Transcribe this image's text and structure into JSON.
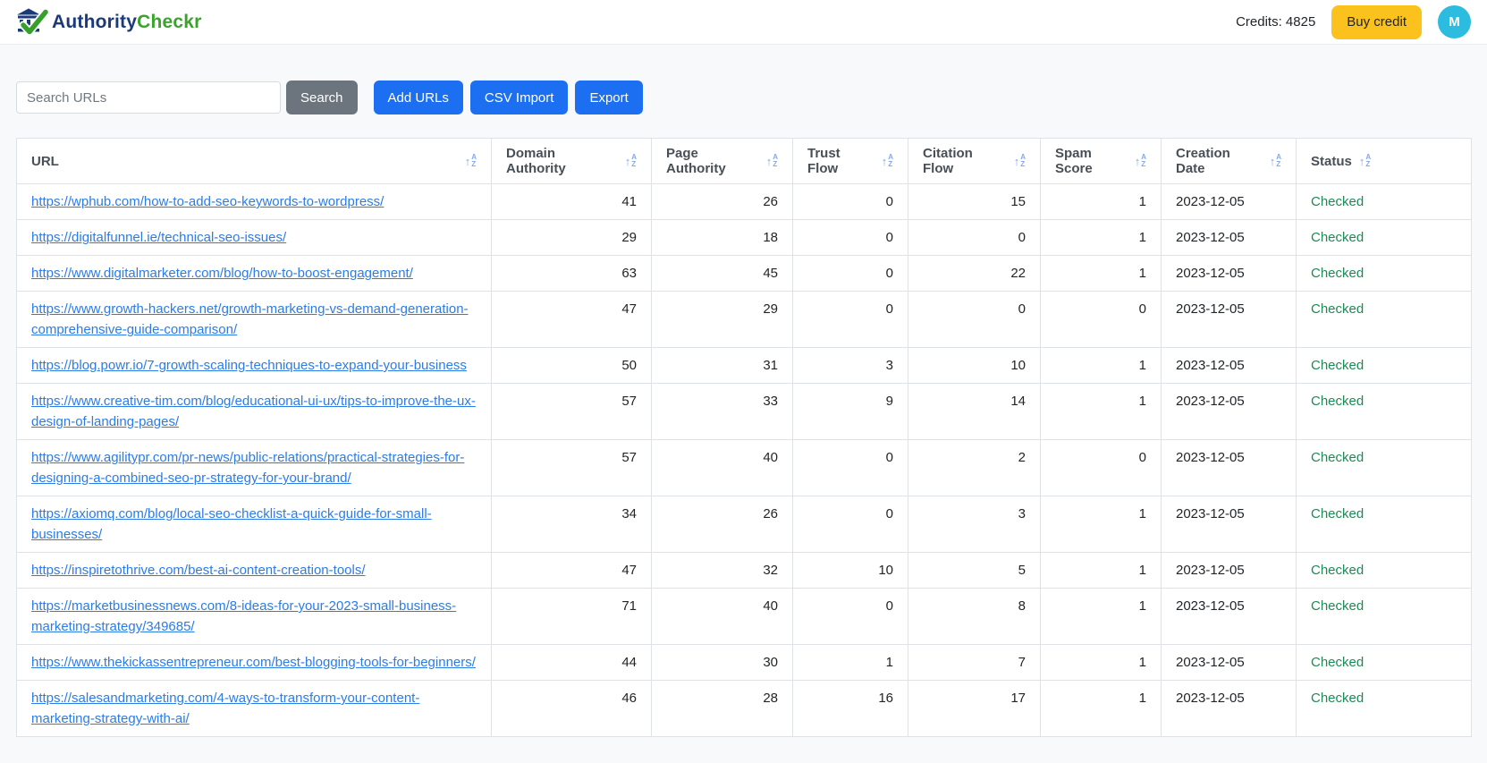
{
  "brand": {
    "name_part1": "Authority",
    "name_part2": "Checkr",
    "logo_icon": "bank-with-checkmark"
  },
  "header": {
    "credits_text": "Credits: 4825",
    "buy_credit_label": "Buy credit",
    "avatar_initial": "M"
  },
  "toolbar": {
    "search_placeholder": "Search URLs",
    "search_button_label": "Search",
    "add_urls_button_label": "Add URLs",
    "csv_import_button_label": "CSV Import",
    "export_button_label": "Export"
  },
  "table": {
    "columns": [
      "URL",
      "Domain Authority",
      "Page Authority",
      "Trust Flow",
      "Citation Flow",
      "Spam Score",
      "Creation Date",
      "Status"
    ],
    "rows": [
      {
        "url": "https://wphub.com/how-to-add-seo-keywords-to-wordpress/",
        "domain_authority": 41,
        "page_authority": 26,
        "trust_flow": 0,
        "citation_flow": 15,
        "spam_score": 1,
        "creation_date": "2023-12-05",
        "status": "Checked"
      },
      {
        "url": "https://digitalfunnel.ie/technical-seo-issues/",
        "domain_authority": 29,
        "page_authority": 18,
        "trust_flow": 0,
        "citation_flow": 0,
        "spam_score": 1,
        "creation_date": "2023-12-05",
        "status": "Checked"
      },
      {
        "url": "https://www.digitalmarketer.com/blog/how-to-boost-engagement/",
        "domain_authority": 63,
        "page_authority": 45,
        "trust_flow": 0,
        "citation_flow": 22,
        "spam_score": 1,
        "creation_date": "2023-12-05",
        "status": "Checked"
      },
      {
        "url": "https://www.growth-hackers.net/growth-marketing-vs-demand-generation-comprehensive-guide-comparison/",
        "domain_authority": 47,
        "page_authority": 29,
        "trust_flow": 0,
        "citation_flow": 0,
        "spam_score": 0,
        "creation_date": "2023-12-05",
        "status": "Checked"
      },
      {
        "url": "https://blog.powr.io/7-growth-scaling-techniques-to-expand-your-business",
        "domain_authority": 50,
        "page_authority": 31,
        "trust_flow": 3,
        "citation_flow": 10,
        "spam_score": 1,
        "creation_date": "2023-12-05",
        "status": "Checked"
      },
      {
        "url": "https://www.creative-tim.com/blog/educational-ui-ux/tips-to-improve-the-ux-design-of-landing-pages/",
        "domain_authority": 57,
        "page_authority": 33,
        "trust_flow": 9,
        "citation_flow": 14,
        "spam_score": 1,
        "creation_date": "2023-12-05",
        "status": "Checked"
      },
      {
        "url": "https://www.agilitypr.com/pr-news/public-relations/practical-strategies-for-designing-a-combined-seo-pr-strategy-for-your-brand/",
        "domain_authority": 57,
        "page_authority": 40,
        "trust_flow": 0,
        "citation_flow": 2,
        "spam_score": 0,
        "creation_date": "2023-12-05",
        "status": "Checked"
      },
      {
        "url": "https://axiomq.com/blog/local-seo-checklist-a-quick-guide-for-small-businesses/",
        "domain_authority": 34,
        "page_authority": 26,
        "trust_flow": 0,
        "citation_flow": 3,
        "spam_score": 1,
        "creation_date": "2023-12-05",
        "status": "Checked"
      },
      {
        "url": "https://inspiretothrive.com/best-ai-content-creation-tools/",
        "domain_authority": 47,
        "page_authority": 32,
        "trust_flow": 10,
        "citation_flow": 5,
        "spam_score": 1,
        "creation_date": "2023-12-05",
        "status": "Checked"
      },
      {
        "url": "https://marketbusinessnews.com/8-ideas-for-your-2023-small-business-marketing-strategy/349685/",
        "domain_authority": 71,
        "page_authority": 40,
        "trust_flow": 0,
        "citation_flow": 8,
        "spam_score": 1,
        "creation_date": "2023-12-05",
        "status": "Checked"
      },
      {
        "url": "https://www.thekickassentrepreneur.com/best-blogging-tools-for-beginners/",
        "domain_authority": 44,
        "page_authority": 30,
        "trust_flow": 1,
        "citation_flow": 7,
        "spam_score": 1,
        "creation_date": "2023-12-05",
        "status": "Checked"
      },
      {
        "url": "https://salesandmarketing.com/4-ways-to-transform-your-content-marketing-strategy-with-ai/",
        "domain_authority": 46,
        "page_authority": 28,
        "trust_flow": 16,
        "citation_flow": 17,
        "spam_score": 1,
        "creation_date": "2023-12-05",
        "status": "Checked"
      }
    ]
  },
  "colors": {
    "accent_blue": "#1d6ff2",
    "link_blue": "#2b7ce9",
    "buy_credit_yellow": "#fbc21d",
    "avatar_cyan": "#2bbcdf",
    "status_green": "#1d8a55",
    "search_gray": "#6c757d",
    "brand_navy": "#1b3a7a",
    "brand_green": "#3aa32c"
  }
}
